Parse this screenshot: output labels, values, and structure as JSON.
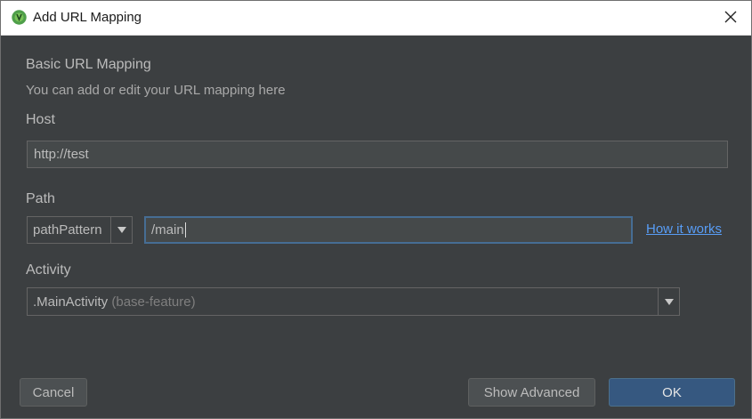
{
  "window": {
    "title": "Add URL Mapping",
    "icon": "android-studio-icon",
    "close_icon": "close-icon"
  },
  "section": {
    "heading": "Basic URL Mapping",
    "description": "You can add or edit your URL mapping here"
  },
  "host": {
    "label": "Host",
    "value": "http://test"
  },
  "path": {
    "label": "Path",
    "type_selected": "pathPattern",
    "value": "/main",
    "help_link": "How it works"
  },
  "activity": {
    "label": "Activity",
    "selected_name": ".MainActivity",
    "selected_module": "(base-feature)"
  },
  "buttons": {
    "cancel": "Cancel",
    "show_advanced": "Show Advanced",
    "ok": "OK"
  },
  "colors": {
    "background": "#3c3f41",
    "primary_button": "#365880",
    "link": "#589df6",
    "focus_border": "#466d94"
  }
}
